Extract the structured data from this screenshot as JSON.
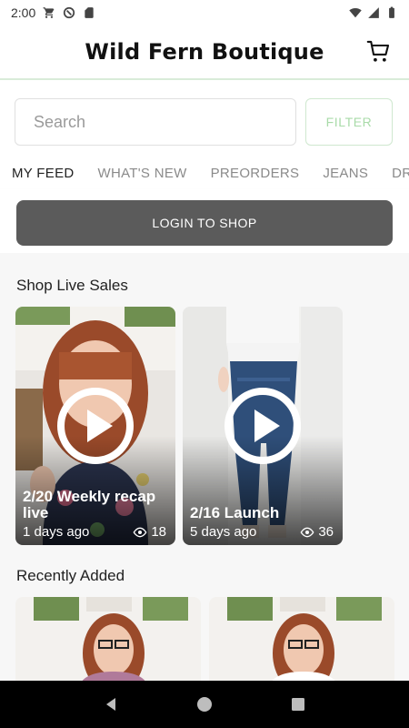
{
  "status": {
    "time": "2:00"
  },
  "app": {
    "title": "Wild Fern Boutique"
  },
  "search": {
    "placeholder": "Search",
    "value": ""
  },
  "filter": {
    "label": "FILTER"
  },
  "tabs": [
    {
      "label": "MY FEED",
      "active": true
    },
    {
      "label": "WHAT'S NEW",
      "active": false
    },
    {
      "label": "PREORDERS",
      "active": false
    },
    {
      "label": "JEANS",
      "active": false
    },
    {
      "label": "DRI",
      "active": false
    }
  ],
  "login": {
    "label": "LOGIN TO SHOP"
  },
  "sections": {
    "live": {
      "title": "Shop Live Sales",
      "cards": [
        {
          "title": "2/20 Weekly recap live",
          "age": "1 days ago",
          "views": "18"
        },
        {
          "title": "2/16 Launch",
          "age": "5 days ago",
          "views": "36"
        }
      ]
    },
    "recent": {
      "title": "Recently Added"
    }
  },
  "colors": {
    "accent_green": "#bfe3bf",
    "filter_text": "#a9dba9",
    "login_bg": "#5b5b5b",
    "nav_bg": "#000000"
  }
}
